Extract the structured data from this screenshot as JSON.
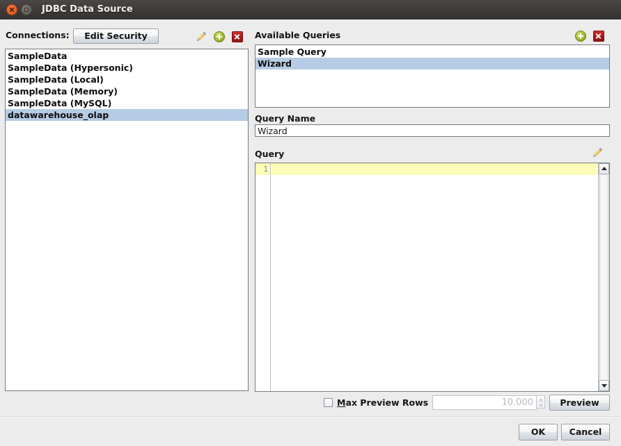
{
  "window": {
    "title": "JDBC Data Source",
    "close_icon": "close-icon",
    "maximize_icon": "maximize-icon"
  },
  "connections": {
    "label": "Connections:",
    "edit_security_label": "Edit Security",
    "edit_icon": "pencil-icon",
    "add_icon": "plus-icon",
    "delete_icon": "delete-icon",
    "items": [
      {
        "label": "SampleData",
        "selected": false
      },
      {
        "label": "SampleData (Hypersonic)",
        "selected": false
      },
      {
        "label": "SampleData (Local)",
        "selected": false
      },
      {
        "label": "SampleData (Memory)",
        "selected": false
      },
      {
        "label": "SampleData (MySQL)",
        "selected": false
      },
      {
        "label": "datawarehouse_olap",
        "selected": true
      }
    ]
  },
  "queries": {
    "label": "Available Queries",
    "add_icon": "plus-icon",
    "delete_icon": "delete-icon",
    "items": [
      {
        "label": "Sample Query",
        "selected": false
      },
      {
        "label": "Wizard",
        "selected": true
      }
    ]
  },
  "query_name": {
    "label": "Query Name",
    "value": "Wizard"
  },
  "query_editor": {
    "label": "Query",
    "edit_icon": "pencil-icon",
    "line_number": "1",
    "content": "",
    "scroll_up_icon": "scroll-up-arrow-icon",
    "scroll_down_icon": "scroll-down-arrow-icon"
  },
  "footer": {
    "max_preview_rows_label_prefix": "M",
    "max_preview_rows_label_rest": "ax Preview Rows",
    "max_preview_rows_checked": false,
    "max_preview_rows_value": "10.000",
    "preview_label": "Preview",
    "ok_label": "OK",
    "cancel_label": "Cancel"
  },
  "colors": {
    "selection": "#b6cbe4",
    "editor_current_line": "#fdfcb8",
    "dialog_background": "#ececec",
    "titlebar": "#3d3a37"
  }
}
